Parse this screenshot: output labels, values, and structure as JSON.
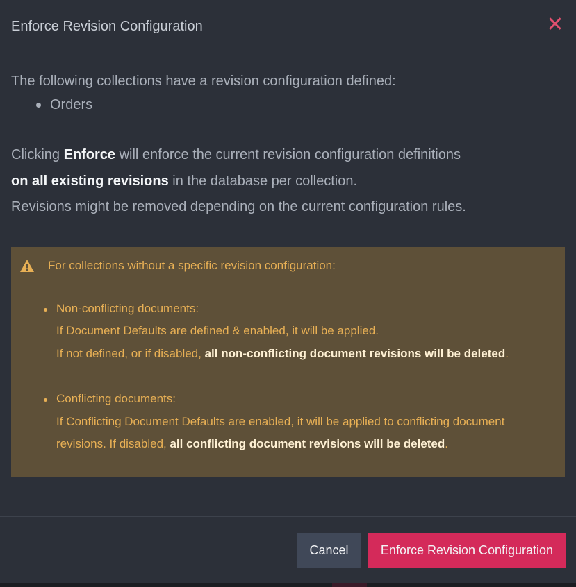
{
  "dialog": {
    "title": "Enforce Revision Configuration",
    "close_icon": "close-icon",
    "close_symbol": "✕"
  },
  "intro": {
    "text": "The following collections have a revision configuration defined:",
    "collections": [
      "Orders"
    ]
  },
  "explain": {
    "p1_a": "Clicking ",
    "p1_b": "Enforce",
    "p1_c": " will enforce the current revision configuration definitions",
    "p2_a": "on all existing revisions",
    "p2_b": " in the database per collection.",
    "p3": "Revisions might be removed depending on the current configuration rules."
  },
  "warning": {
    "icon": "warning-icon",
    "heading": "For collections without a specific revision configuration:",
    "items": [
      {
        "title": "Non-conflicting documents:",
        "line1": "If Document Defaults are defined & enabled, it will be applied.",
        "line2_a": "If not defined, or if disabled, ",
        "line2_b": "all non-conflicting document revisions will be deleted",
        "line2_c": "."
      },
      {
        "title": "Conflicting documents:",
        "line1": "If Conflicting Document Defaults are enabled, it will be applied to conflicting document",
        "line2_a": "revisions. If disabled, ",
        "line2_b": "all conflicting document revisions will be deleted",
        "line2_c": "."
      }
    ]
  },
  "footer": {
    "cancel_label": "Cancel",
    "enforce_label": "Enforce Revision Configuration"
  },
  "colors": {
    "background": "#2c3039",
    "warning_bg": "#5e5038",
    "warning_text": "#e8b055",
    "accent": "#d42a5a",
    "close": "#e2506f"
  }
}
